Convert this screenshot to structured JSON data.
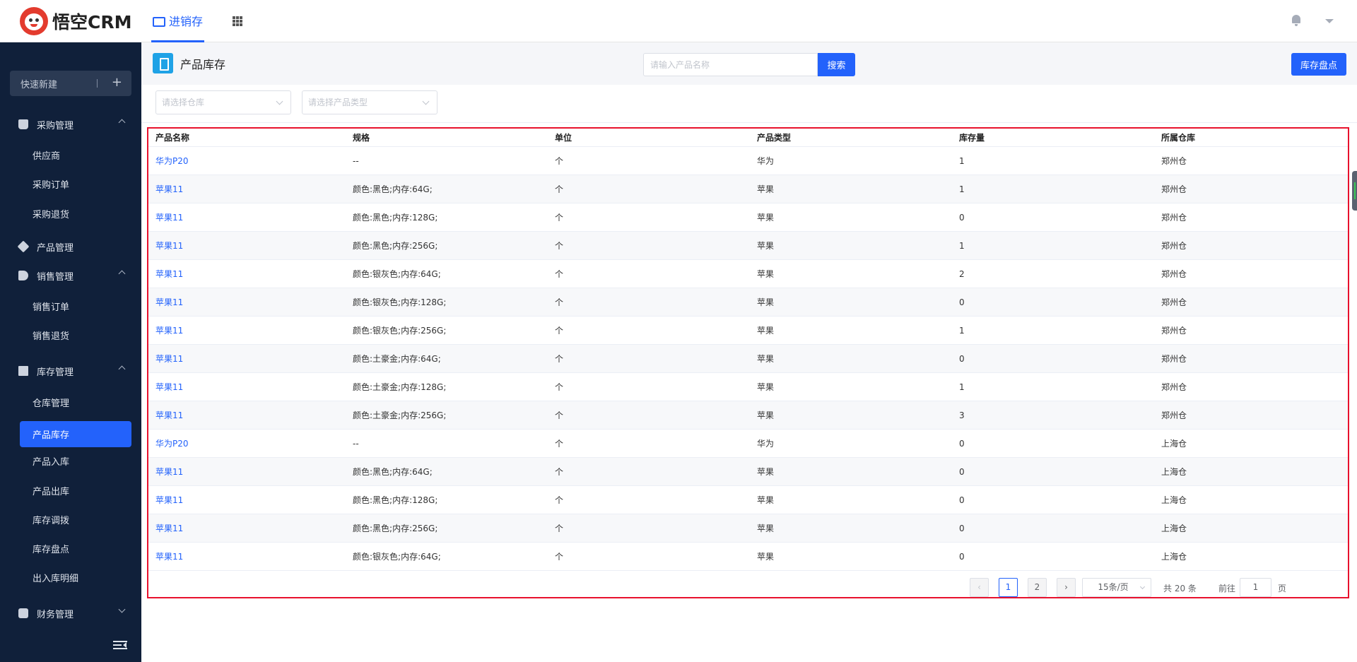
{
  "app": {
    "brand": "悟空CRM"
  },
  "topnav": {
    "active_tab": "进销存"
  },
  "sidebar": {
    "quick_new": "快速新建",
    "groups": [
      {
        "label": "采购管理",
        "items": [
          "供应商",
          "采购订单",
          "采购退货"
        ]
      },
      {
        "label": "产品管理",
        "items": []
      },
      {
        "label": "销售管理",
        "items": [
          "销售订单",
          "销售退货"
        ]
      },
      {
        "label": "库存管理",
        "items": [
          "仓库管理",
          "产品库存",
          "产品入库",
          "产品出库",
          "库存调拨",
          "库存盘点",
          "出入库明细"
        ]
      },
      {
        "label": "财务管理",
        "items": []
      }
    ],
    "active_item": "产品库存"
  },
  "page": {
    "title": "产品库存",
    "search_placeholder": "请输入产品名称",
    "search_button": "搜索",
    "action_button": "库存盘点"
  },
  "filters": {
    "warehouse_placeholder": "请选择仓库",
    "type_placeholder": "请选择产品类型"
  },
  "table": {
    "columns": [
      "产品名称",
      "规格",
      "单位",
      "产品类型",
      "库存量",
      "所属仓库"
    ],
    "rows": [
      [
        "华为P20",
        "--",
        "个",
        "华为",
        "1",
        "郑州仓"
      ],
      [
        "苹果11",
        "颜色:黑色;内存:64G;",
        "个",
        "苹果",
        "1",
        "郑州仓"
      ],
      [
        "苹果11",
        "颜色:黑色;内存:128G;",
        "个",
        "苹果",
        "0",
        "郑州仓"
      ],
      [
        "苹果11",
        "颜色:黑色;内存:256G;",
        "个",
        "苹果",
        "1",
        "郑州仓"
      ],
      [
        "苹果11",
        "颜色:银灰色;内存:64G;",
        "个",
        "苹果",
        "2",
        "郑州仓"
      ],
      [
        "苹果11",
        "颜色:银灰色;内存:128G;",
        "个",
        "苹果",
        "0",
        "郑州仓"
      ],
      [
        "苹果11",
        "颜色:银灰色;内存:256G;",
        "个",
        "苹果",
        "1",
        "郑州仓"
      ],
      [
        "苹果11",
        "颜色:土豪金;内存:64G;",
        "个",
        "苹果",
        "0",
        "郑州仓"
      ],
      [
        "苹果11",
        "颜色:土豪金;内存:128G;",
        "个",
        "苹果",
        "1",
        "郑州仓"
      ],
      [
        "苹果11",
        "颜色:土豪金;内存:256G;",
        "个",
        "苹果",
        "3",
        "郑州仓"
      ],
      [
        "华为P20",
        "--",
        "个",
        "华为",
        "0",
        "上海仓"
      ],
      [
        "苹果11",
        "颜色:黑色;内存:64G;",
        "个",
        "苹果",
        "0",
        "上海仓"
      ],
      [
        "苹果11",
        "颜色:黑色;内存:128G;",
        "个",
        "苹果",
        "0",
        "上海仓"
      ],
      [
        "苹果11",
        "颜色:黑色;内存:256G;",
        "个",
        "苹果",
        "0",
        "上海仓"
      ],
      [
        "苹果11",
        "颜色:银灰色;内存:64G;",
        "个",
        "苹果",
        "0",
        "上海仓"
      ]
    ]
  },
  "pagination": {
    "pages": [
      "1",
      "2"
    ],
    "current": "1",
    "page_size": "15条/页",
    "total": "共 20 条",
    "goto_prefix": "前往",
    "goto_value": "1",
    "goto_suffix": "页"
  },
  "colors": {
    "primary": "#2362fb",
    "sidebar_bg": "#10203a",
    "highlight_border": "#e8112d"
  }
}
